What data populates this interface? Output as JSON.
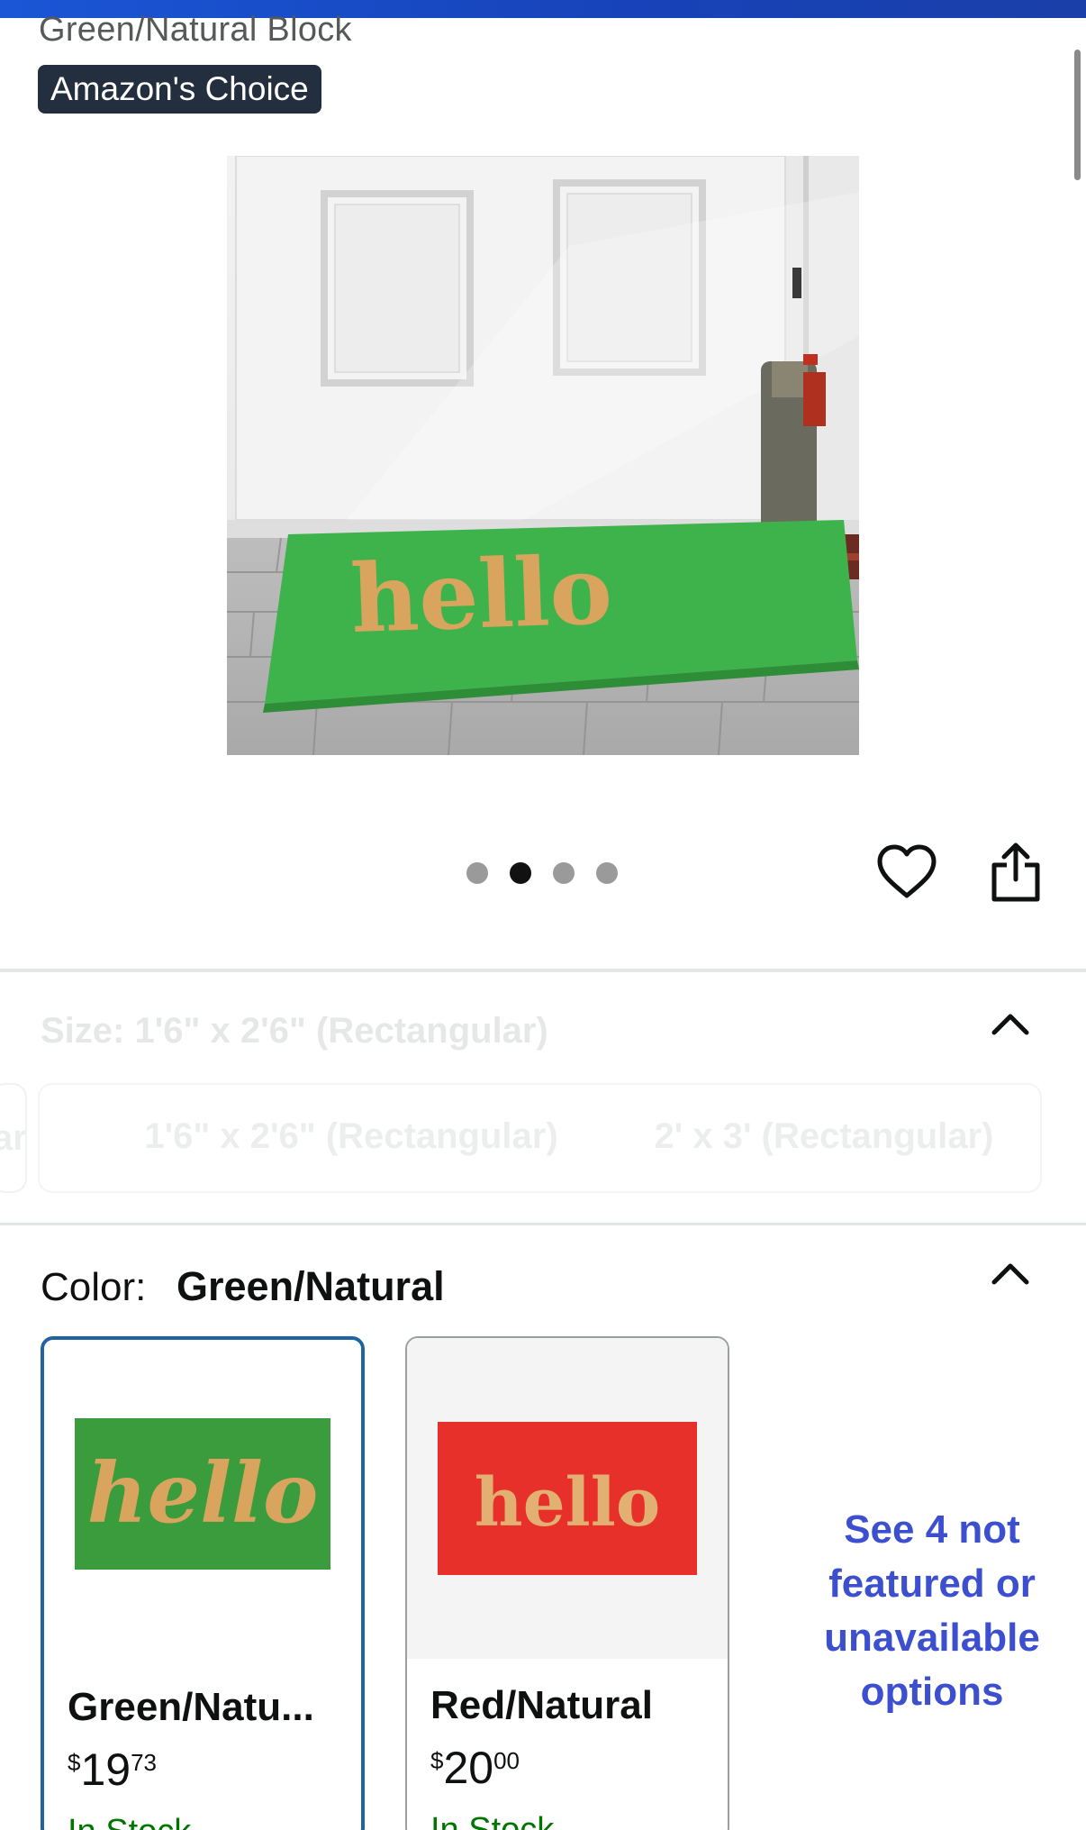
{
  "header": {
    "variant_title": "Green/Natural Block",
    "badge": "Amazon's Choice"
  },
  "hero_image": {
    "mat_text": "hello",
    "mat_color": "#3bb54a",
    "text_color": "#d4a05a"
  },
  "carousel": {
    "dot_count": 4,
    "active_index": 1
  },
  "actions": {
    "wishlist_icon": "heart-icon",
    "share_icon": "share-icon"
  },
  "size_section": {
    "label": "Size: 1'6\" x 2'6\" (Rectangular)",
    "options": [
      "ar",
      "1'6\" x 2'6\" (Rectangular)",
      "2' x 3' (Rectangular)"
    ]
  },
  "color_section": {
    "label": "Color:",
    "selected": "Green/Natural",
    "swatches": [
      {
        "name": "Green/Natu...",
        "currency": "$",
        "dollars": "19",
        "cents": "73",
        "stock": "In Stock",
        "mat_color": "#3a9c3c",
        "text": "hello"
      },
      {
        "name": "Red/Natural",
        "currency": "$",
        "dollars": "20",
        "cents": "00",
        "stock": "In Stock",
        "mat_color": "#e8302a",
        "text": "hello"
      }
    ],
    "see_more": "See 4 not featured or unavailable options"
  },
  "colors": {
    "accent_link": "#3c4fcf",
    "selected_border": "#2162a1",
    "in_stock": "#007600",
    "badge_bg": "#232f3e"
  }
}
